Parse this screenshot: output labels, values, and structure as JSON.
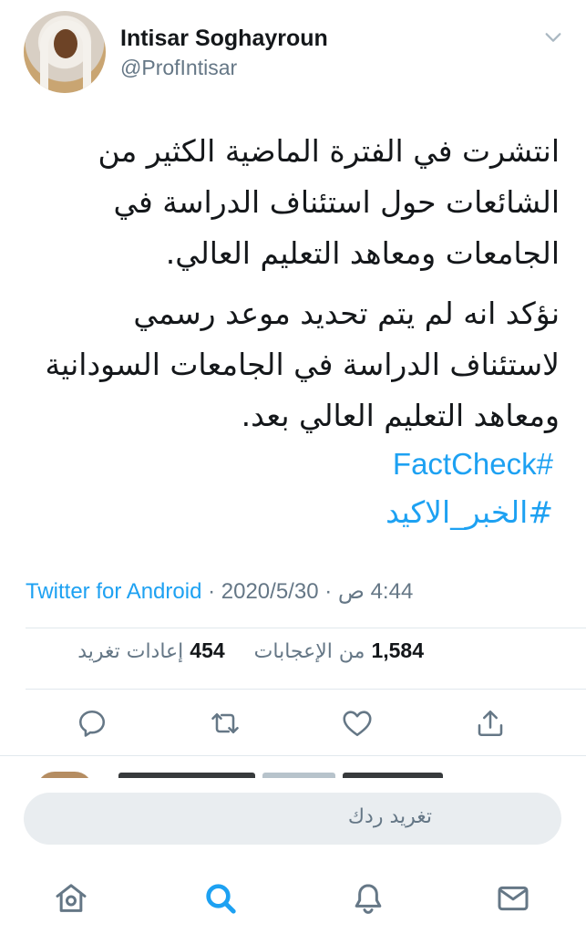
{
  "author": {
    "name": "Intisar Soghayroun",
    "handle": "@ProfIntisar"
  },
  "tweet": {
    "paragraph_1": "انتشرت في الفترة الماضية الكثير من الشائعات حول استئناف الدراسة في الجامعات ومعاهد التعليم العالي.",
    "paragraph_2": "نؤكد انه لم يتم تحديد موعد رسمي لاستئناف الدراسة في الجامعات السودانية ومعاهد التعليم العالي بعد.",
    "hashtag_1": "#FactCheck",
    "hashtag_2": "#الخبر_الاكيد"
  },
  "meta": {
    "time": "4:44 ص",
    "sep": "·",
    "date": "2020/5/30",
    "source": "Twitter for Android"
  },
  "stats": {
    "likes_count": "1,584",
    "likes_label": "من الإعجابات",
    "retweets_count": "454",
    "retweets_label": "إعادات تغريد"
  },
  "reply": {
    "placeholder": "تغريد ردك"
  },
  "icons": {
    "reply": "reply-icon",
    "retweet": "retweet-icon",
    "like": "heart-icon",
    "share": "share-icon",
    "home": "home-icon",
    "search": "search-icon",
    "notifications": "bell-icon",
    "messages": "mail-icon"
  },
  "colors": {
    "accent": "#1da1f2",
    "secondary_text": "#657786",
    "divider": "#e1e8ed"
  }
}
